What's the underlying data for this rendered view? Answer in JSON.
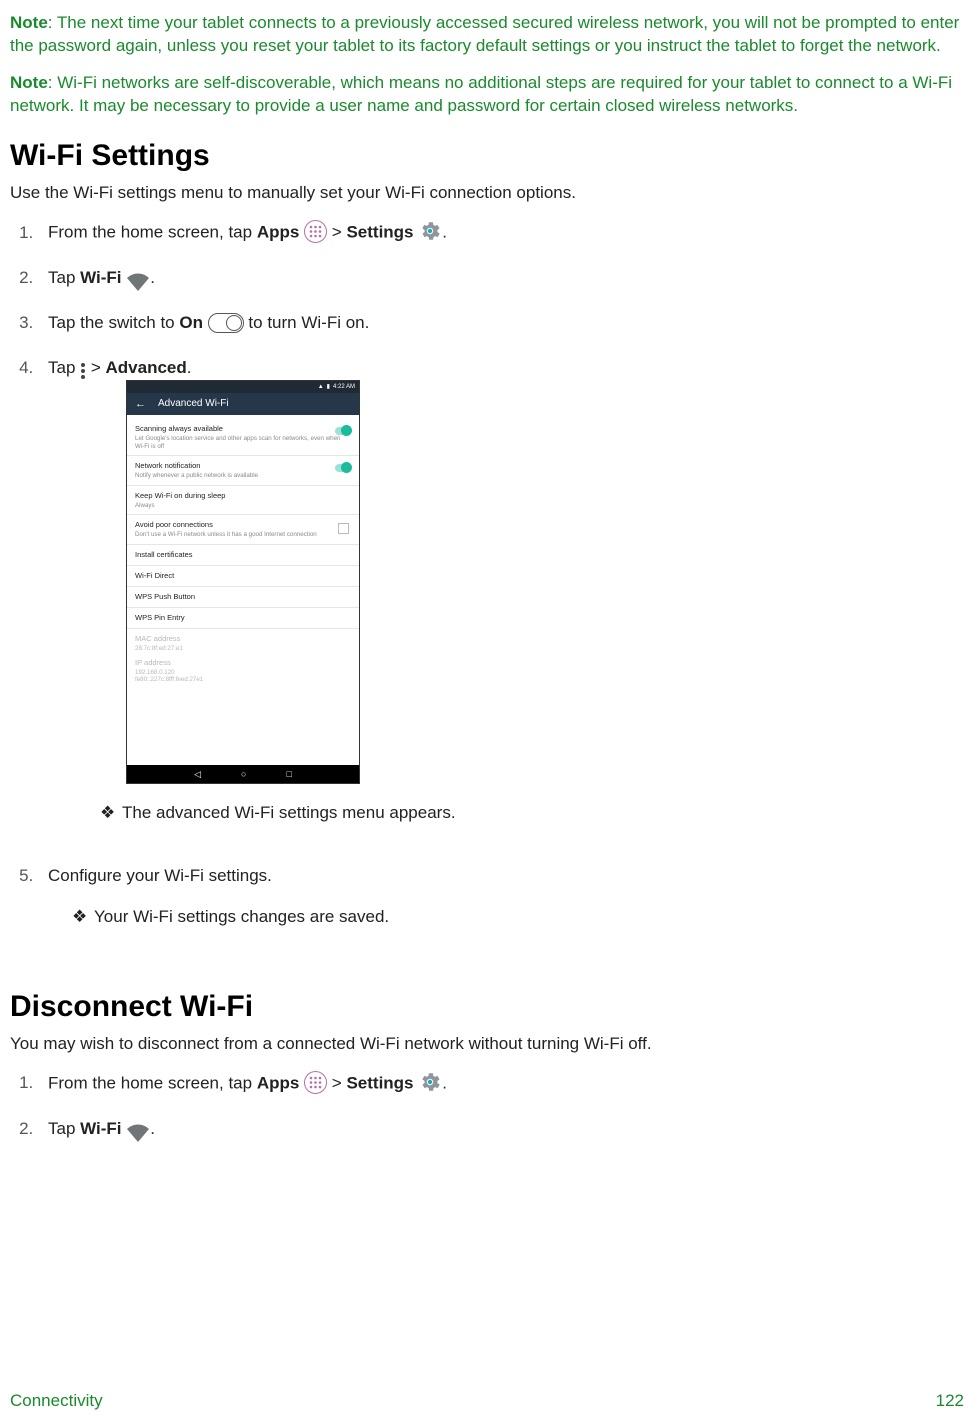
{
  "notes": {
    "n1_label": "Note",
    "n1_text": ": The next time your tablet connects to a previously accessed secured wireless network, you will not be prompted to enter the password again, unless you reset your tablet to its factory default settings or you instruct the tablet to forget the network.",
    "n2_label": "Note",
    "n2_text": ": Wi-Fi networks are self-discoverable, which means no additional steps are required for your tablet to connect to a Wi-Fi network. It may be necessary to provide a user name and password for certain closed wireless networks."
  },
  "sec1": {
    "heading": "Wi-Fi Settings",
    "lead": "Use the Wi-Fi settings menu to manually set your Wi-Fi connection options.",
    "steps": {
      "s1a": "From the home screen, tap ",
      "s1_apps": "Apps",
      "s1_gt": " > ",
      "s1_settings": "Settings",
      "s2a": "Tap ",
      "s2_wifi": "Wi-Fi",
      "s3a": "Tap the switch to ",
      "s3_on": "On",
      "s3b": " to turn Wi-Fi on.",
      "s4a": "Tap ",
      "s4b": " > ",
      "s4_adv": "Advanced",
      "s5": "Configure your Wi-Fi settings."
    },
    "subs": {
      "a": "The advanced Wi-Fi settings menu appears.",
      "b": "Your Wi-Fi settings changes are saved."
    }
  },
  "device": {
    "clock": "4:22 AM",
    "title": "Advanced Wi-Fi",
    "rows": {
      "r1t": "Scanning always available",
      "r1s": "Let Google's location service and other apps scan for networks, even when Wi-Fi is off",
      "r2t": "Network notification",
      "r2s": "Notify whenever a public network is available",
      "r3t": "Keep Wi-Fi on during sleep",
      "r3s": "Always",
      "r4t": "Avoid poor connections",
      "r4s": "Don't use a Wi-Fi network unless it has a good Internet connection",
      "r5t": "Install certificates",
      "r6t": "Wi-Fi Direct",
      "r7t": "WPS Push Button",
      "r8t": "WPS Pin Entry",
      "r9t": "MAC address",
      "r9s": "28:7c:8f:ed:27:e1",
      "r10t": "IP address",
      "r10s": "192.168.0.120\nfe80::227c:8fff:feed:27e1"
    }
  },
  "sec2": {
    "heading": "Disconnect Wi-Fi",
    "lead": "You may wish to disconnect from a connected Wi-Fi network without turning Wi-Fi off.",
    "steps": {
      "s1a": "From the home screen, tap ",
      "s1_apps": "Apps",
      "s1_gt": " > ",
      "s1_settings": "Settings",
      "s2a": "Tap ",
      "s2_wifi": "Wi-Fi"
    }
  },
  "footer": {
    "left": "Connectivity",
    "right": "122"
  }
}
